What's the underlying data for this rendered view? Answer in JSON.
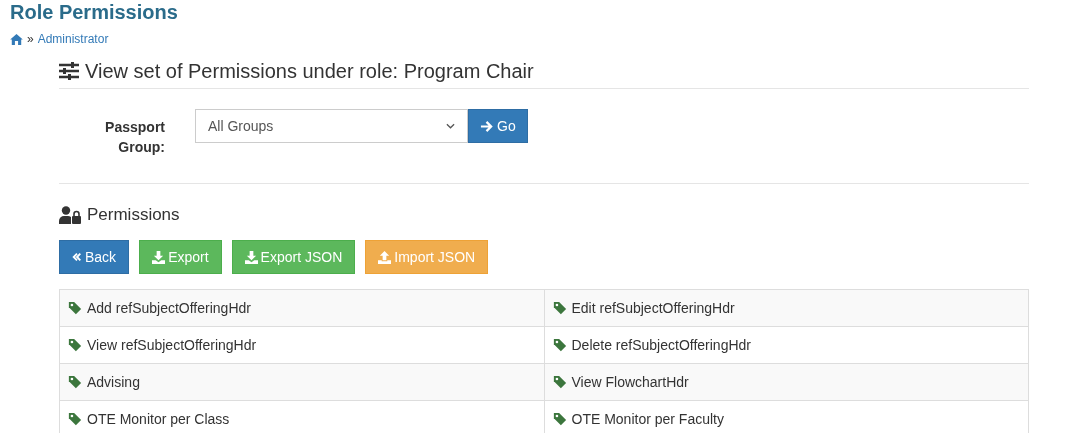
{
  "page_title": "Role Permissions",
  "breadcrumb": {
    "link": "Administrator",
    "separator": "»"
  },
  "heading": "View set of Permissions under role: Program Chair",
  "form": {
    "label": "Passport Group:",
    "select_value": "All Groups",
    "go_button": "Go"
  },
  "permissions_heading": "Permissions",
  "buttons": [
    {
      "label": "Back",
      "kind": "back"
    },
    {
      "label": "Export",
      "kind": "export"
    },
    {
      "label": "Export JSON",
      "kind": "export"
    },
    {
      "label": "Import JSON",
      "kind": "import"
    }
  ],
  "rows": [
    [
      "Add refSubjectOfferingHdr",
      "Edit refSubjectOfferingHdr"
    ],
    [
      "View refSubjectOfferingHdr",
      "Delete refSubjectOfferingHdr"
    ],
    [
      "Advising",
      "View FlowchartHdr"
    ],
    [
      "OTE Monitor per Class",
      "OTE Monitor per Faculty"
    ]
  ]
}
